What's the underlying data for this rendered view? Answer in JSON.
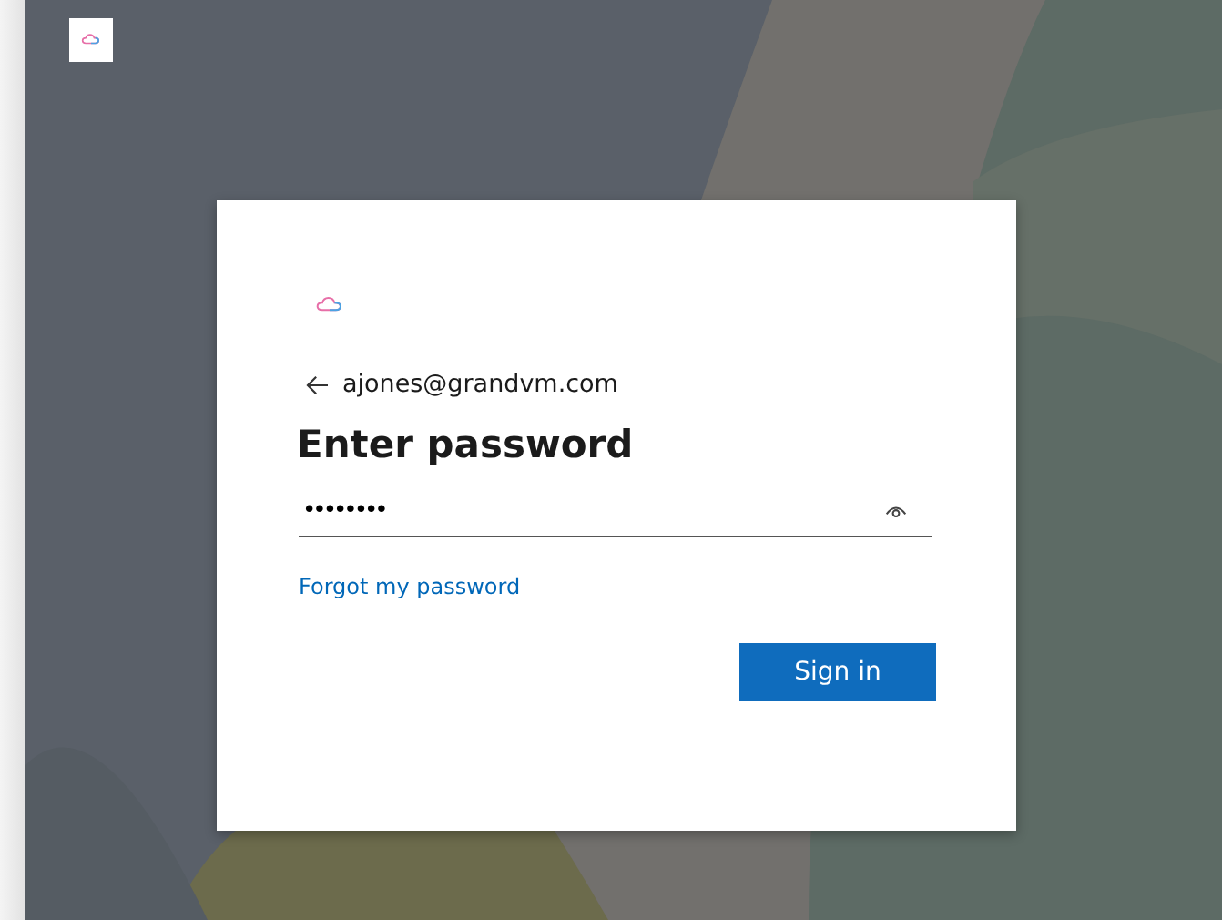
{
  "identity": {
    "email": "ajones@grandvm.com"
  },
  "heading": "Enter password",
  "password": {
    "value": "••••••••"
  },
  "forgot_link": "Forgot my password",
  "buttons": [
    {
      "label": "Sign in",
      "kind": "primary"
    }
  ]
}
